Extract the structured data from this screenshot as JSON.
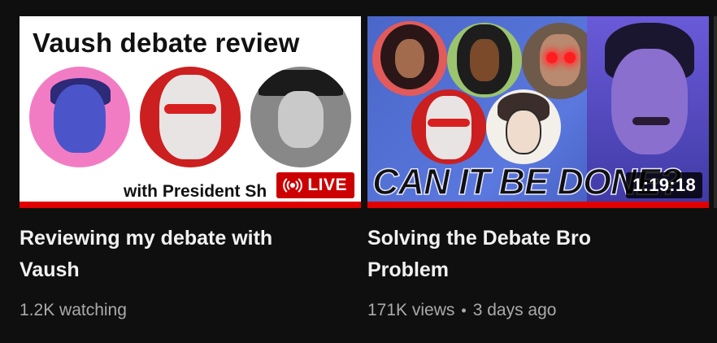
{
  "videos": [
    {
      "thumbnail_title": "Vaush debate review",
      "thumbnail_subtitle": "with President Sh",
      "badge": "LIVE",
      "badge_icon": "live-broadcast-icon",
      "title_line1": "Reviewing my debate with",
      "title_line2": "Vaush",
      "meta": "1.2K watching"
    },
    {
      "thumbnail_caption": "CAN IT BE DONE?",
      "duration": "1:19:18",
      "title_line1": "Solving the Debate Bro",
      "title_line2": "Problem",
      "views": "171K views",
      "separator": "•",
      "age": "3 days ago"
    }
  ],
  "colors": {
    "background": "#0f0f0f",
    "live_red": "#cc0000",
    "progress_red": "#e00000",
    "title_text": "#f1f1f1",
    "meta_text": "#aaaaaa"
  }
}
